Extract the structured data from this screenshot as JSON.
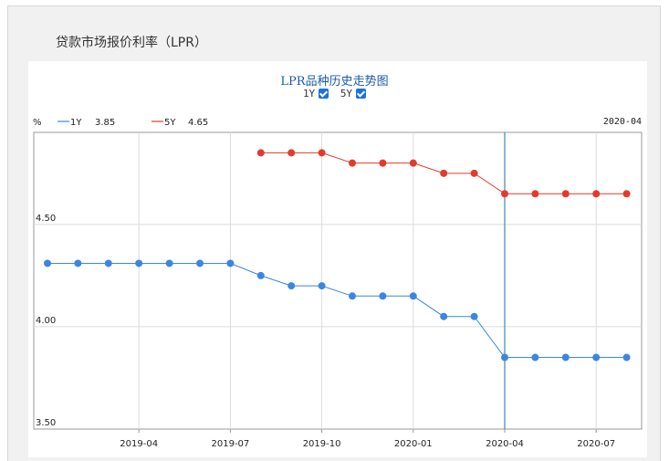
{
  "section_title": "贷款市场报价利率（LPR）",
  "legend_toggles": [
    {
      "label": "1Y",
      "checked": true
    },
    {
      "label": "5Y",
      "checked": true
    }
  ],
  "header": {
    "unit_label": "%",
    "series_readouts": [
      {
        "name": "1Y",
        "value": "3.85"
      },
      {
        "name": "5Y",
        "value": "4.65"
      }
    ],
    "cursor_date": "2020-04"
  },
  "colors": {
    "1Y": "#3b87df",
    "5Y": "#e23b2e",
    "cursor": "#1a6fa8",
    "grid": "#dcdcdc",
    "axis": "#999999"
  },
  "chart_data": {
    "type": "line",
    "title": "LPR品种历史走势图",
    "xlabel": "",
    "ylabel": "%",
    "ylim": [
      3.5,
      4.95
    ],
    "yticks": [
      3.5,
      4.0,
      4.5
    ],
    "ytick_labels": [
      "3.50",
      "4.00",
      "4.50"
    ],
    "x": [
      "2019-01",
      "2019-02",
      "2019-03",
      "2019-04",
      "2019-05",
      "2019-06",
      "2019-07",
      "2019-08",
      "2019-09",
      "2019-10",
      "2019-11",
      "2019-12",
      "2020-01",
      "2020-02",
      "2020-03",
      "2020-04",
      "2020-05",
      "2020-06",
      "2020-07",
      "2020-08"
    ],
    "xtick_labels": [
      "2019-04",
      "2019-07",
      "2019-10",
      "2020-01",
      "2020-04",
      "2020-07"
    ],
    "cursor_x": "2020-04",
    "grid": true,
    "series": [
      {
        "name": "1Y",
        "values": [
          4.31,
          4.31,
          4.31,
          4.31,
          4.31,
          4.31,
          4.31,
          4.25,
          4.2,
          4.2,
          4.15,
          4.15,
          4.15,
          4.05,
          4.05,
          3.85,
          3.85,
          3.85,
          3.85,
          3.85
        ]
      },
      {
        "name": "5Y",
        "values": [
          null,
          null,
          null,
          null,
          null,
          null,
          null,
          4.85,
          4.85,
          4.85,
          4.8,
          4.8,
          4.8,
          4.75,
          4.75,
          4.65,
          4.65,
          4.65,
          4.65,
          4.65
        ]
      }
    ]
  }
}
